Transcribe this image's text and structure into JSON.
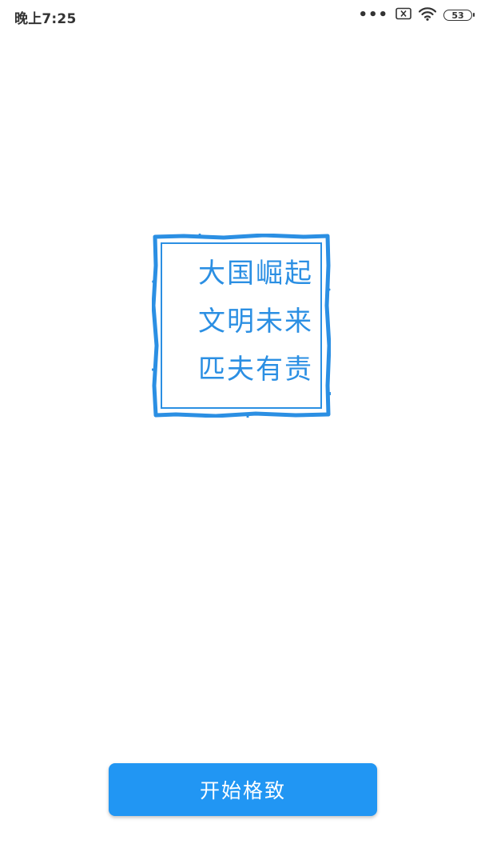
{
  "status_bar": {
    "time": "晚上7:25",
    "dots": "•••",
    "battery_level": "53",
    "icons": [
      "more-dots-icon",
      "sim-error-icon",
      "wifi-icon",
      "battery-icon"
    ]
  },
  "stamp": {
    "lines": [
      "大国崛起",
      "文明未来",
      "匹夫有责"
    ],
    "color": "#2b8fe3"
  },
  "start_button": {
    "label": "开始格致",
    "color": "#2196f3"
  }
}
